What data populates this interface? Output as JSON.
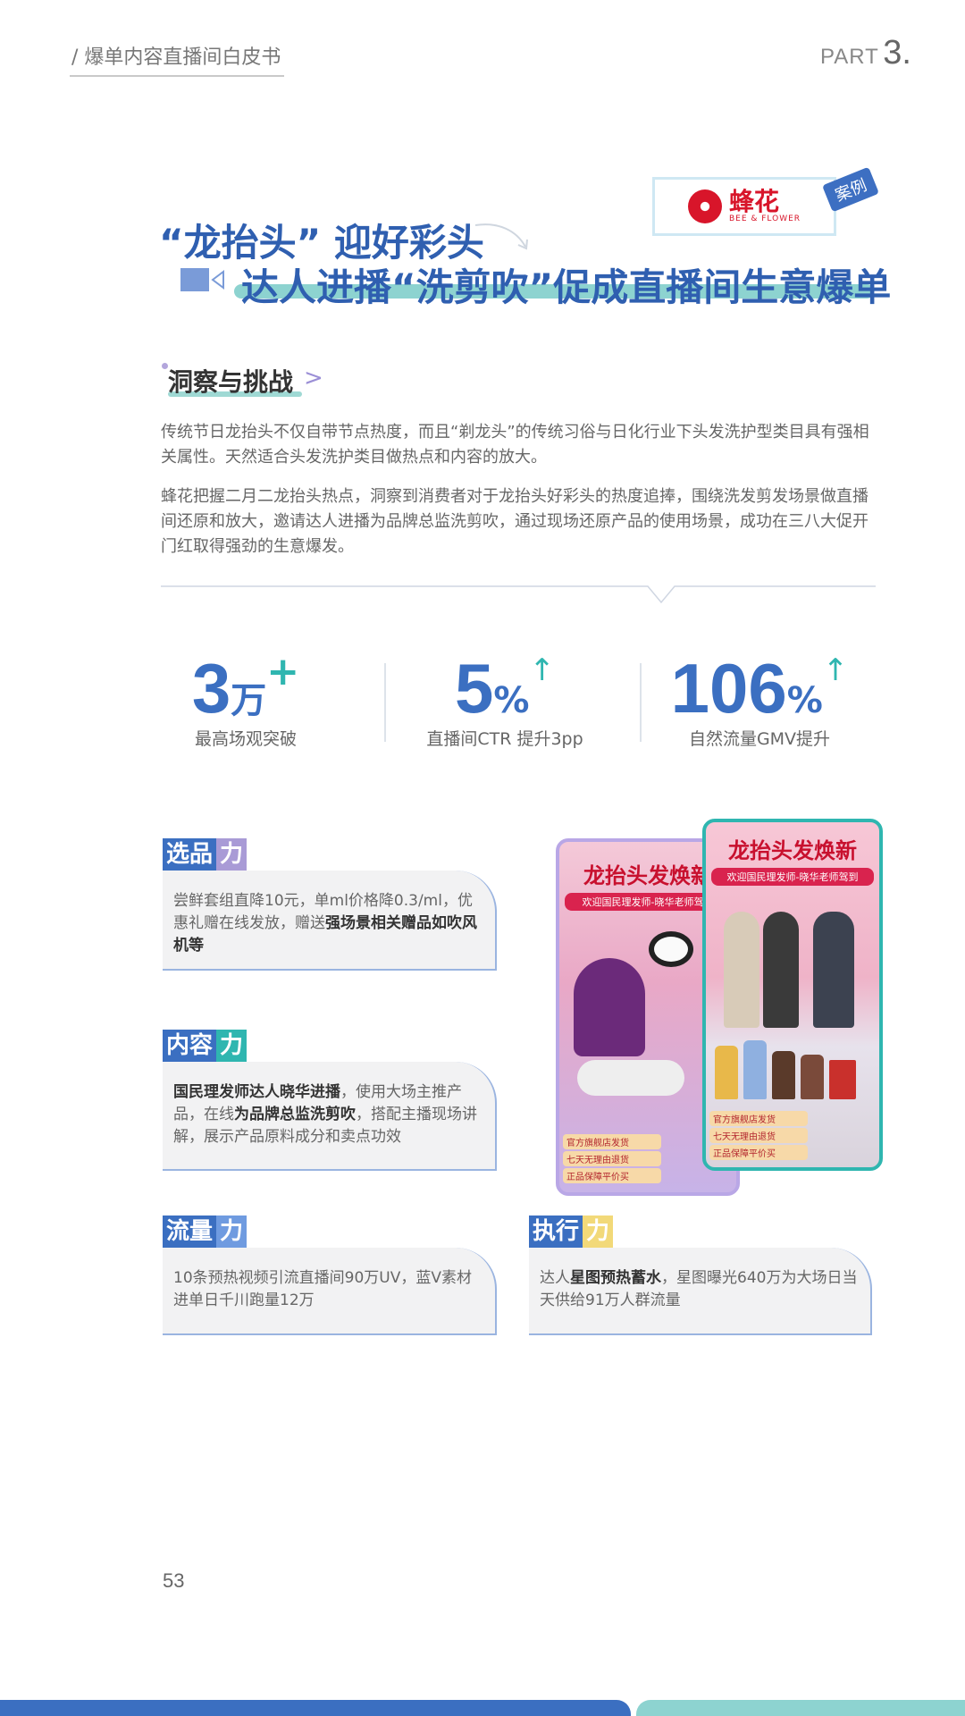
{
  "header": {
    "title": "/  爆单内容直播间白皮书",
    "part_label": "PART",
    "part_num": "3."
  },
  "brand": {
    "name": "蜂花",
    "sub": "BEE & FLOWER",
    "case_tag": "案例"
  },
  "title": {
    "line1": "“龙抬头” 迎好彩头",
    "line2": "达人进播“洗剪吹”促成直播间生意爆单"
  },
  "section": {
    "heading": "洞察与挑战",
    "chevron": ">"
  },
  "paragraphs": [
    "传统节日龙抬头不仅自带节点热度，而且“剃龙头”的传统习俗与日化行业下头发洗护型类目具有强相关属性。天然适合头发洗护类目做热点和内容的放大。",
    "蜂花把握二月二龙抬头热点，洞察到消费者对于龙抬头好彩头的热度追捧，围绕洗发剪发场景做直播间还原和放大，邀请达人进播为品牌总监洗剪吹，通过现场还原产品的使用场景，成功在三八大促开门红取得强劲的生意爆发。"
  ],
  "stats": [
    {
      "num": "3",
      "unit": "万",
      "mark": "+",
      "label": "最高场观突破"
    },
    {
      "num": "5",
      "unit": "%",
      "mark": "↑",
      "label": "直播间CTR   提升3pp"
    },
    {
      "num": "106",
      "unit": "%",
      "mark": "↑",
      "label": "自然流量GMV提升"
    }
  ],
  "cards": {
    "select": {
      "l1": "选品",
      "l2": "力",
      "color": "#a99bd6",
      "t1": "尝鲜套组直降10元，单ml价格降0.3/ml，优惠礼赠在线发放，赠送",
      "t2": "强场景相关赠品如吹风机等"
    },
    "content": {
      "l1": "内容",
      "l2": "力",
      "color": "#2fb6b0",
      "b1": "国民理发师达人晓华进播",
      "t1": "，使用大场主推产品，在线",
      "b2": "为品牌总监洗剪吹",
      "t2": "，搭配主播现场讲解，展示产品原料成分和卖点功效"
    },
    "traffic": {
      "l1": "流量",
      "l2": "力",
      "color": "#6f9be0",
      "t1": "10条预热视频引流直播间90万UV，蓝V素材进单日千川跑量12万"
    },
    "exec": {
      "l1": "执行",
      "l2": "力",
      "color": "#f2d979",
      "t1": "达人",
      "b1": "星图预热蓄水",
      "t2": "，星图曝光640万为大场日当天供给91万人群流量"
    }
  },
  "photos": {
    "back": {
      "title": "龙抬头发焕新",
      "banner": "欢迎国民理发师-晓华老师驾到",
      "tags": [
        "官方旗舰店发货",
        "七天无理由退货",
        "正品保障平价买"
      ]
    },
    "front": {
      "title": "龙抬头发焕新",
      "banner": "欢迎国民理发师-晓华老师驾到",
      "tags": [
        "官方旗舰店发货",
        "七天无理由退货",
        "正品保障平价买"
      ]
    }
  },
  "page_number": "53"
}
